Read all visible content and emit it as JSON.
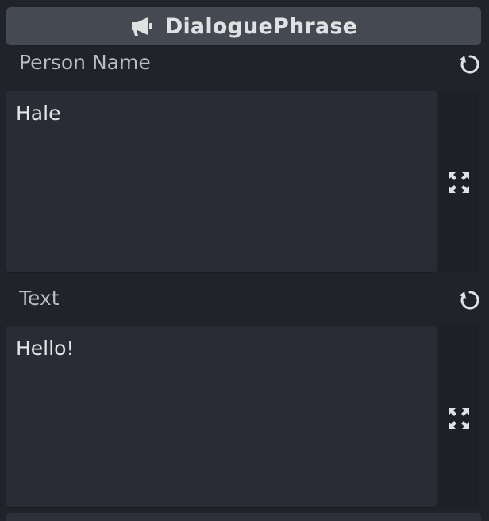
{
  "inspector": {
    "title": "DialoguePhrase",
    "title_icon": "megaphone-icon"
  },
  "properties": [
    {
      "label": "Person Name",
      "value": "Hale"
    },
    {
      "label": "Text",
      "value": "Hello!"
    }
  ],
  "icons": {
    "revert": "revert-icon",
    "expand": "expand-icon"
  },
  "colors": {
    "background": "#20232a",
    "header": "#454952",
    "editor": "#292c35",
    "text": "#e4e5e8",
    "label": "#b9bcc2"
  }
}
